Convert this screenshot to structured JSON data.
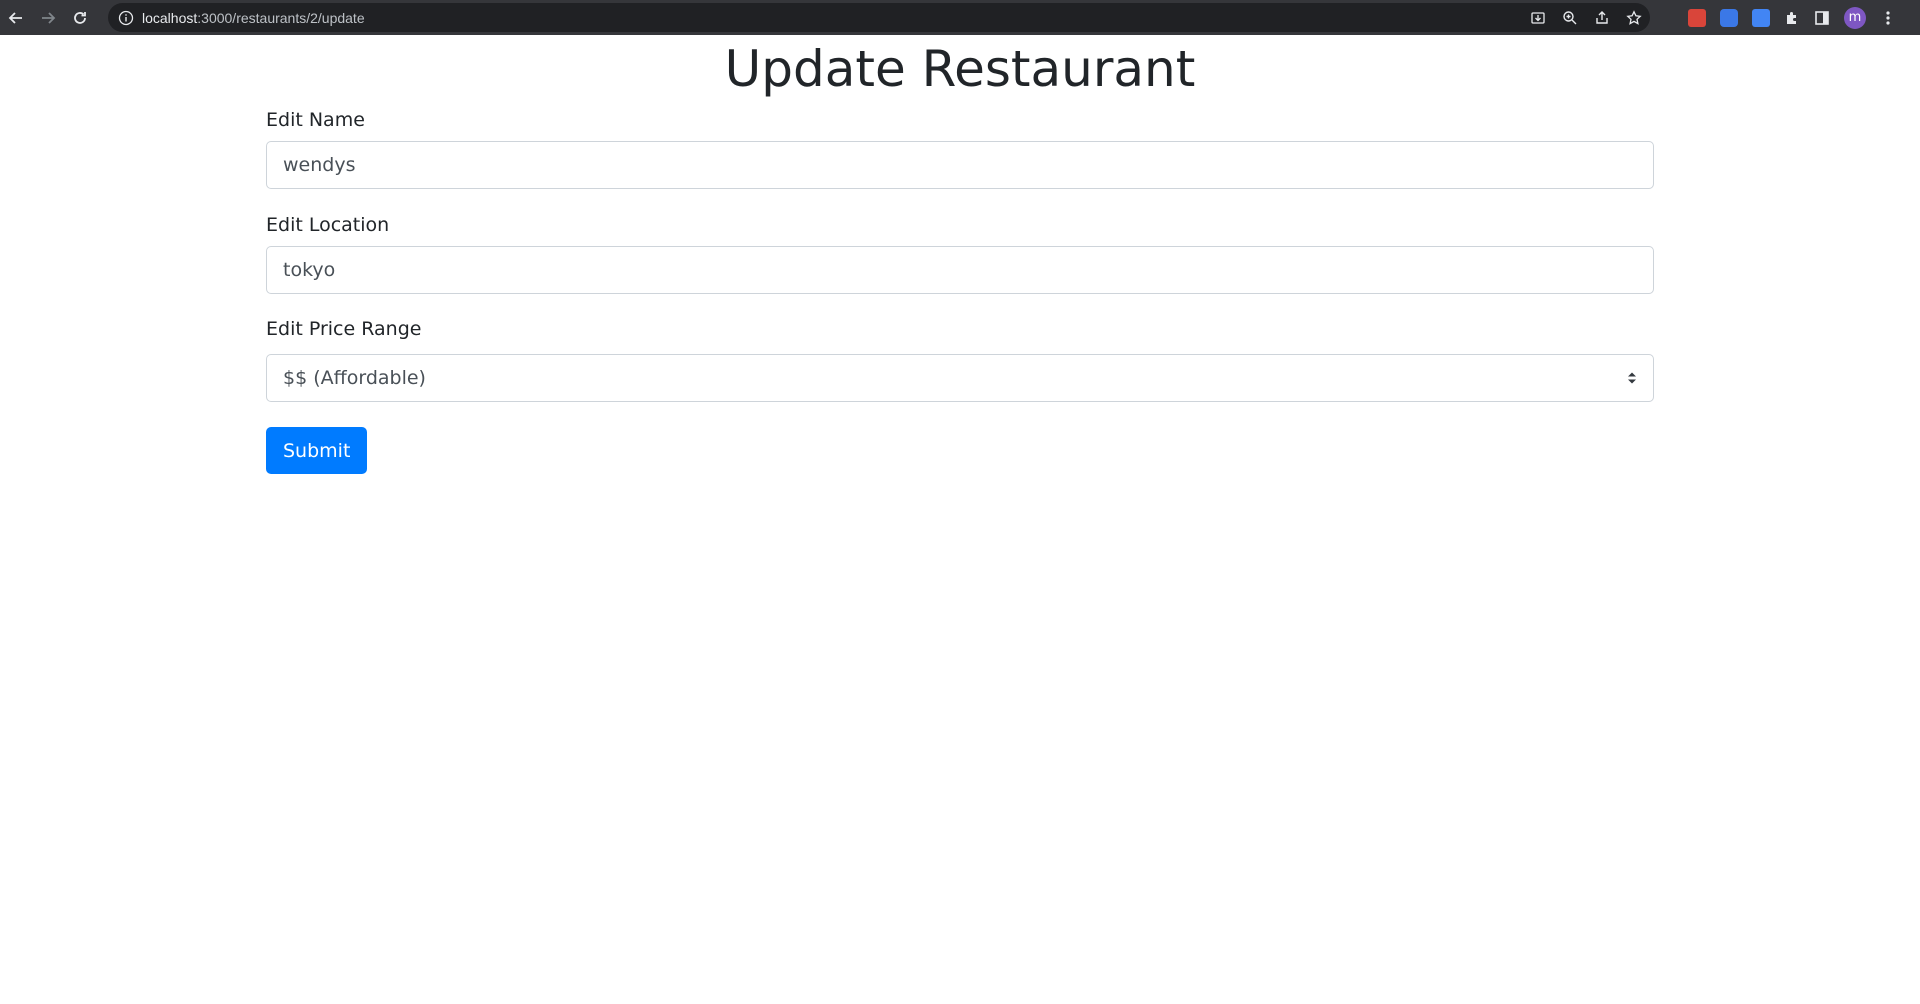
{
  "browser": {
    "url_host": "localhost",
    "url_path": ":3000/restaurants/2/update",
    "avatar_letter": "m",
    "colors": {
      "toolbar_bg": "#35363a",
      "omnibox_bg": "#202124",
      "avatar_bg": "#7e57c2"
    }
  },
  "page": {
    "title": "Update Restaurant",
    "name_label": "Edit Name",
    "name_value": "wendys",
    "location_label": "Edit Location",
    "location_value": "tokyo",
    "price_label": "Edit Price Range",
    "price_selected": "$$ (Affordable)",
    "submit_label": "Submit",
    "colors": {
      "primary": "#007bff",
      "text": "#212529",
      "input_border": "#ced4da"
    }
  }
}
